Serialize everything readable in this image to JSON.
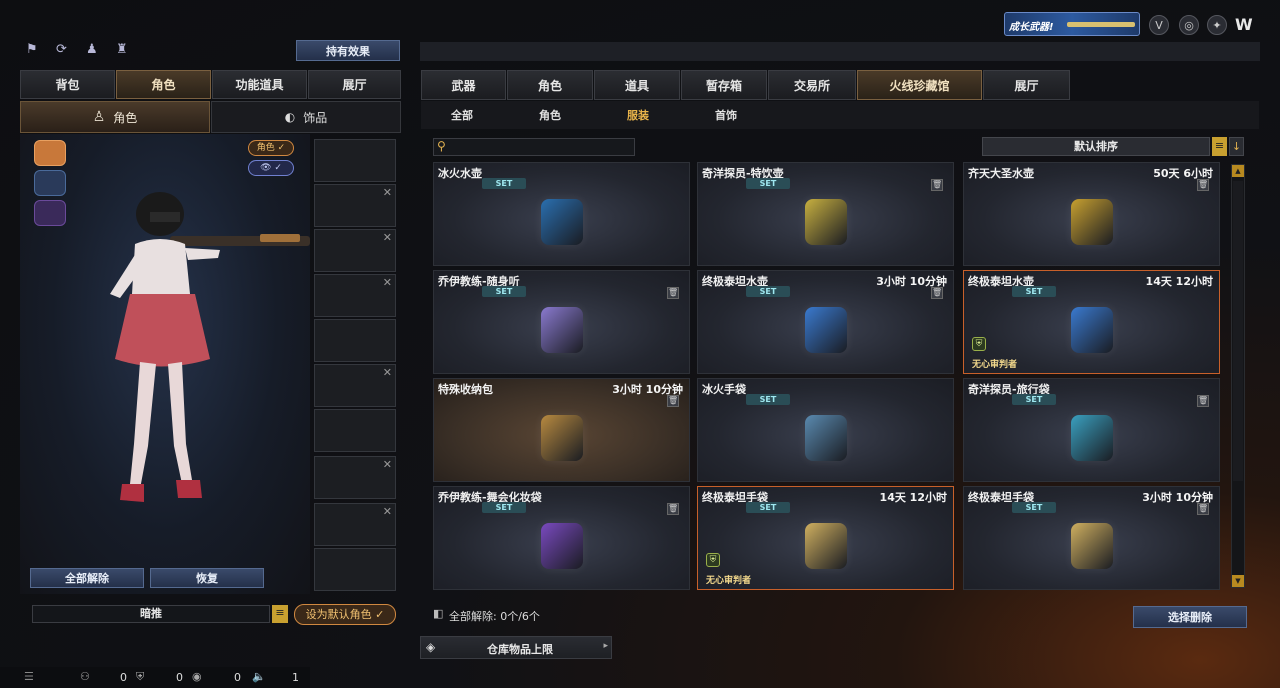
{
  "top_left_icons": [
    "team-icon",
    "rotate-icon",
    "person-icon",
    "bag-icon"
  ],
  "hold_effect": "持有效果",
  "left_tabs": [
    "背包",
    "角色",
    "功能道具",
    "展厅"
  ],
  "left_active_tab": 1,
  "char_subtabs": [
    {
      "label": "角色",
      "icon": "character-icon"
    },
    {
      "label": "饰品",
      "icon": "ornament-icon"
    }
  ],
  "char_badges": {
    "role": "角色 ✓",
    "eye": "👁 ✓"
  },
  "btn_remove_all": "全部解除",
  "btn_restore": "恢复",
  "char_name": "暗推",
  "btn_set_default": "设为默认角色 ✓",
  "right_tabs": [
    "武器",
    "角色",
    "道具",
    "暂存箱",
    "交易所",
    "火线珍藏馆",
    "展厅"
  ],
  "right_active_tab": 5,
  "right_subtabs": [
    "全部",
    "角色",
    "服装",
    "首饰"
  ],
  "right_active_subtab": 2,
  "search": {
    "placeholder": ""
  },
  "sort_label": "默认排序",
  "items": [
    {
      "name": "冰火水壶",
      "time": "",
      "set": "SET",
      "del": false,
      "hl": false,
      "warm": false,
      "judge": ""
    },
    {
      "name": "奇洋探员-特饮壶",
      "time": "",
      "set": "SET",
      "del": true,
      "hl": false,
      "warm": false,
      "judge": ""
    },
    {
      "name": "齐天大圣水壶",
      "time": "50天 6小时",
      "set": "",
      "del": true,
      "hl": false,
      "warm": false,
      "judge": ""
    },
    {
      "name": "乔伊教练-随身听",
      "time": "",
      "set": "SET",
      "del": true,
      "hl": false,
      "warm": false,
      "judge": ""
    },
    {
      "name": "终极泰坦水壶",
      "time": "3小时 10分钟",
      "set": "SET",
      "del": true,
      "hl": false,
      "warm": false,
      "judge": ""
    },
    {
      "name": "终极泰坦水壶",
      "time": "14天 12小时",
      "set": "SET",
      "del": false,
      "hl": true,
      "warm": false,
      "judge": "无心审判者"
    },
    {
      "name": "特殊收纳包",
      "time": "3小时 10分钟",
      "set": "",
      "del": true,
      "hl": false,
      "warm": true,
      "judge": ""
    },
    {
      "name": "冰火手袋",
      "time": "",
      "set": "SET",
      "del": false,
      "hl": false,
      "warm": false,
      "judge": ""
    },
    {
      "name": "奇洋探员-旅行袋",
      "time": "",
      "set": "SET",
      "del": true,
      "hl": false,
      "warm": false,
      "judge": ""
    },
    {
      "name": "乔伊教练-舞会化妆袋",
      "time": "",
      "set": "SET",
      "del": true,
      "hl": false,
      "warm": false,
      "judge": ""
    },
    {
      "name": "终极泰坦手袋",
      "time": "14天 12小时",
      "set": "SET",
      "del": false,
      "hl": true,
      "warm": false,
      "judge": "无心审判者"
    },
    {
      "name": "终极泰坦手袋",
      "time": "3小时 10分钟",
      "set": "SET",
      "del": true,
      "hl": false,
      "warm": false,
      "judge": ""
    }
  ],
  "remove_summary_label": "全部解除:",
  "remove_summary_count": "0个/6个",
  "btn_select_remove": "选择删除",
  "warehouse_label": "仓库物品上限",
  "growth_weapon": "成长武器!",
  "status_bar": {
    "a": "0",
    "b": "0",
    "c": "0",
    "d": "1"
  }
}
